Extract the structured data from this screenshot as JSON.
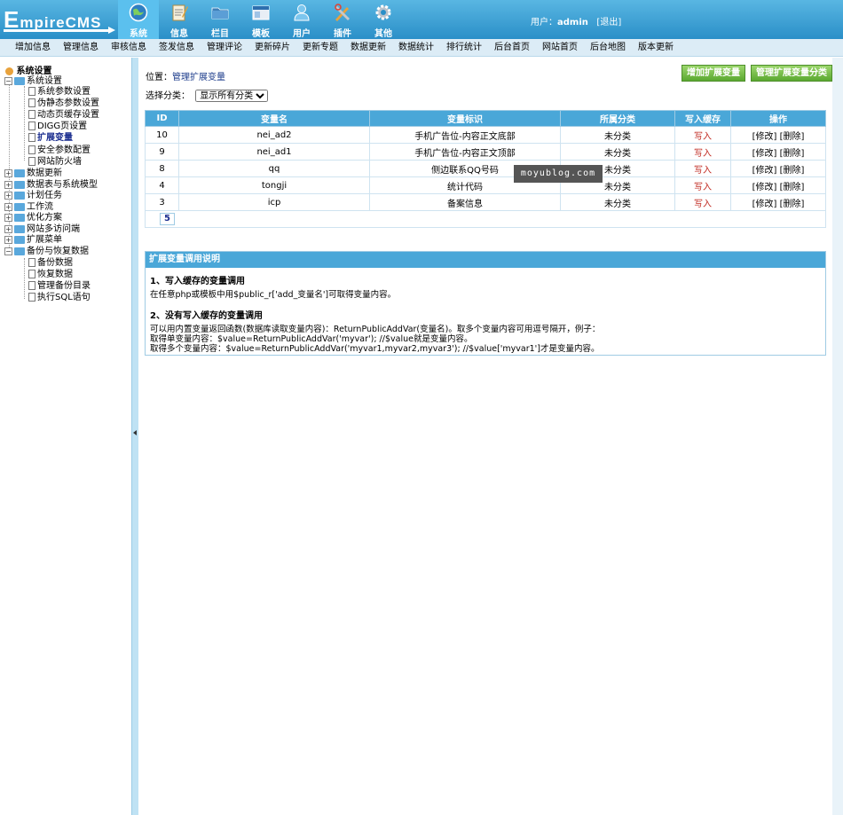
{
  "app": {
    "logo_big": "E",
    "logo_rest": "mpireCMS"
  },
  "topnav": {
    "items": [
      {
        "label": "系统",
        "icon": "globe-icon",
        "active": true
      },
      {
        "label": "信息",
        "icon": "notepad-icon"
      },
      {
        "label": "栏目",
        "icon": "folder-icon"
      },
      {
        "label": "模板",
        "icon": "window-icon"
      },
      {
        "label": "用户",
        "icon": "user-icon"
      },
      {
        "label": "插件",
        "icon": "tools-icon"
      },
      {
        "label": "其他",
        "icon": "gear-icon"
      }
    ]
  },
  "user": {
    "prefix": "用户：",
    "name": "admin",
    "logout": "[退出]"
  },
  "menubar": {
    "items": [
      "增加信息",
      "管理信息",
      "审核信息",
      "签发信息",
      "管理评论",
      "更新碎片",
      "更新专题",
      "数据更新",
      "数据统计",
      "排行统计",
      "后台首页",
      "网站首页",
      "后台地图",
      "版本更新"
    ]
  },
  "sidebar": {
    "root": "系统设置",
    "group_system": "系统设置",
    "system_items": [
      "系统参数设置",
      "伪静态参数设置",
      "动态页缓存设置",
      "DIGG页设置",
      "扩展变量",
      "安全参数配置",
      "网站防火墙"
    ],
    "groups": [
      "数据更新",
      "数据表与系统模型",
      "计划任务",
      "工作流",
      "优化方案",
      "网站多访问端",
      "扩展菜单",
      "备份与恢复数据"
    ],
    "backup_items": [
      "备份数据",
      "恢复数据",
      "管理备份目录",
      "执行SQL语句"
    ]
  },
  "main": {
    "crumb_label": "位置：",
    "crumb_link": "管理扩展变量",
    "filter_label": "选择分类：",
    "filter_selected": "显示所有分类",
    "btn_add": "增加扩展变量",
    "btn_manage": "管理扩展变量分类"
  },
  "table": {
    "headers": [
      "ID",
      "变量名",
      "变量标识",
      "所属分类",
      "写入缓存",
      "操作"
    ],
    "rows": [
      {
        "id": "10",
        "name": "nei_ad2",
        "label": "手机广告位-内容正文底部",
        "cat": "未分类",
        "cache": "写入",
        "ops": "[修改] [删除]"
      },
      {
        "id": "9",
        "name": "nei_ad1",
        "label": "手机广告位-内容正文顶部",
        "cat": "未分类",
        "cache": "写入",
        "ops": "[修改] [删除]"
      },
      {
        "id": "8",
        "name": "qq",
        "label": "侧边联系QQ号码",
        "cat": "未分类",
        "cache": "写入",
        "ops": "[修改] [删除]"
      },
      {
        "id": "4",
        "name": "tongji",
        "label": "统计代码",
        "cat": "未分类",
        "cache": "写入",
        "ops": "[修改] [删除]"
      },
      {
        "id": "3",
        "name": "icp",
        "label": "备案信息",
        "cat": "未分类",
        "cache": "写入",
        "ops": "[修改] [删除]"
      }
    ],
    "pager": "5"
  },
  "help": {
    "title": "扩展变量调用说明",
    "h1": "1、写入缓存的变量调用",
    "p1": "在任意php或模板中用$public_r['add_变量名']可取得变量内容。",
    "h2": "2、没有写入缓存的变量调用",
    "p2": "可以用内置变量返回函数(数据库读取变量内容)：ReturnPublicAddVar(变量名)。取多个变量内容可用逗号隔开，例子：",
    "p3": "取得单变量内容：$value=ReturnPublicAddVar('myvar'); //$value就是变量内容。",
    "p4": "取得多个变量内容：$value=ReturnPublicAddVar('myvar1,myvar2,myvar3'); //$value['myvar1']才是变量内容。"
  },
  "watermark": "moyublog.com"
}
